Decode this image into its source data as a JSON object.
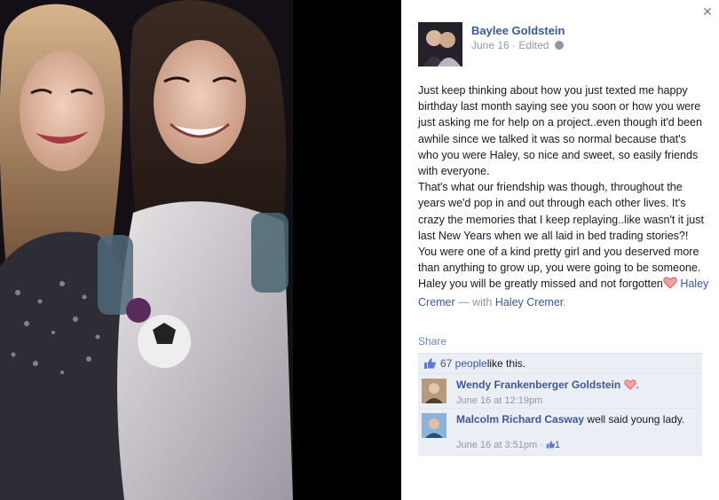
{
  "post": {
    "author": "Baylee Goldstein",
    "date": "June 16",
    "edited": "Edited",
    "paragraph1": "Just keep thinking about how you just texted me happy birthday last month saying see you soon or how you were just asking me for help on a project..even though it'd been awhile since we talked it was so normal because that's who you were Haley, so nice and sweet, so easily friends with everyone.",
    "paragraph2_text": "That's what our friendship was though, throughout the years we'd pop in and out through each other lives. It's crazy the memories that I keep replaying..like wasn't it just last New Years when we all laid in bed trading stories?! You were one of a kind pretty girl and you deserved more than anything to grow up, you were going to be someone. Haley you will be greatly missed and not forgotten",
    "tag_name": "Haley Cremer",
    "with_prefix": " — with ",
    "with_name": "Haley Cremer",
    "period": "."
  },
  "actions": {
    "share": "Share"
  },
  "likes": {
    "count_text": "67 people",
    "suffix": " like this."
  },
  "comments": [
    {
      "name": "Wendy Frankenberger Goldstein",
      "text": "",
      "period": ".",
      "time": "June 16 at 12:19pm"
    },
    {
      "name": "Malcolm Richard Casway",
      "text": " well said young lady.",
      "time": "June 16 at 3:51pm",
      "separator": " · ",
      "like_count": "1"
    }
  ],
  "icons": {
    "close": "close-icon",
    "globe": "globe-icon",
    "heart": "heart-icon",
    "thumb": "thumbs-up-icon"
  },
  "colors": {
    "link": "#3b5998",
    "meta": "#9197a3",
    "ufi_bg": "#eceef5"
  }
}
